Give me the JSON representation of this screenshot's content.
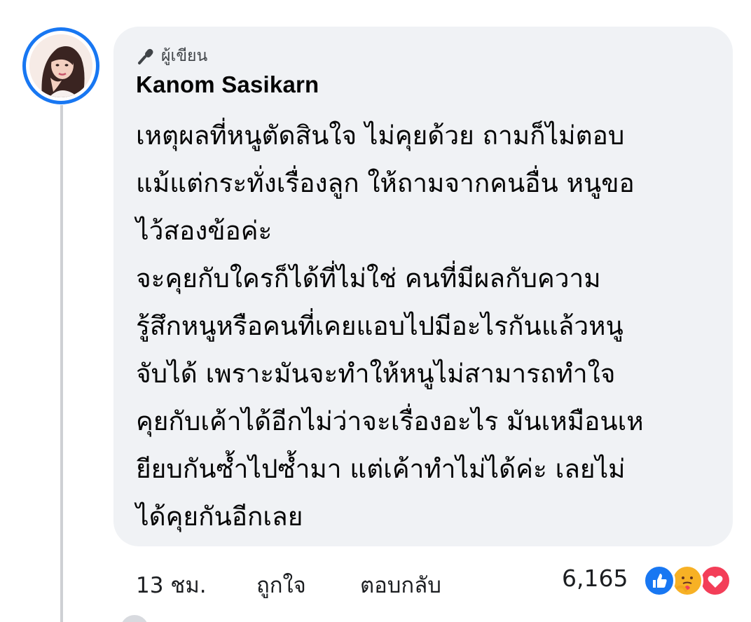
{
  "post": {
    "author_badge": "ผู้เขียน",
    "author_name": "Kanom Sasikarn",
    "lines": [
      "เหตุผลที่หนูตัดสินใจ ไม่คุยด้วย ถามก็ไม่ตอบ",
      "แม้แต่กระทั่งเรื่องลูก ให้ถามจากคนอื่น หนูขอ",
      "ไว้สองข้อค่ะ",
      "จะคุยกับใครก็ได้ที่ไม่ใช่ คนที่มีผลกับความ",
      "รู้สึกหนูหรือคนที่เคยแอบไปมีอะไรกันแล้วหนู",
      "จับได้ เพราะมันจะทำให้หนูไม่สามารถทำใจ",
      "คุยกับเค้าได้อีกไม่ว่าจะเรื่องอะไร มันเหมือนเห",
      "ยียบกันซ้ำไปซ้ำมา แต่เค้าทำไม่ได้ค่ะ เลยไม่",
      "ได้คุยกันอีกเลย"
    ]
  },
  "actions": {
    "timestamp": "13 ชม.",
    "like_label": "ถูกใจ",
    "reply_label": "ตอบกลับ",
    "reaction_count": "6,165",
    "reactions": [
      "like-icon",
      "care-icon",
      "love-icon"
    ]
  },
  "colors": {
    "accent": "#1877f2",
    "bubble": "#f0f2f5",
    "love": "#f33e58",
    "care": "#f7b125"
  }
}
